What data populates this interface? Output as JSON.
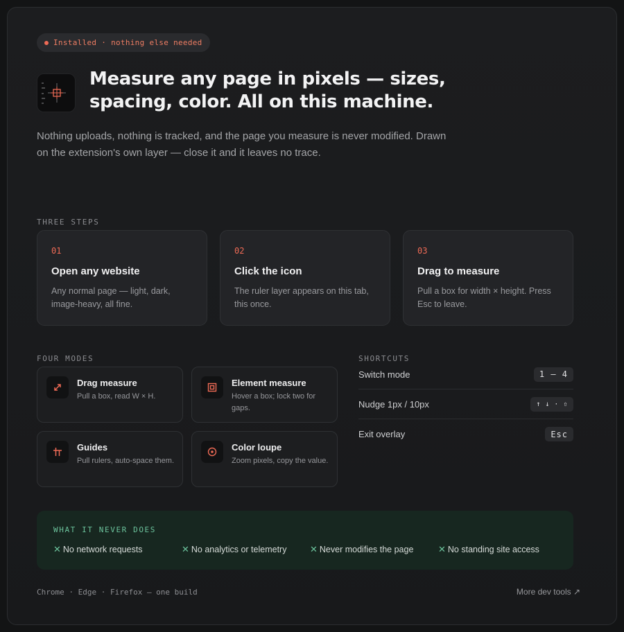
{
  "badge": {
    "text": "Installed · nothing else needed"
  },
  "header": {
    "icon": "crosshair-ruler-icon",
    "title": "Measure any page in pixels — sizes, spacing, color. All on this machine.",
    "subtitle": "Nothing uploads, nothing is tracked, and the page you measure is never modified. Drawn on the extension's own layer — close it and it leaves no trace."
  },
  "steps": {
    "label": "THREE STEPS",
    "items": [
      {
        "num": "01",
        "title": "Open any website",
        "desc": "Any normal page — light, dark, image-heavy, all fine."
      },
      {
        "num": "02",
        "title": "Click the icon",
        "desc": "The ruler layer appears on this tab, this once."
      },
      {
        "num": "03",
        "title": "Drag to measure",
        "desc": "Pull a box for width × height. Press Esc to leave."
      }
    ]
  },
  "modes": {
    "label": "FOUR MODES",
    "items": [
      {
        "icon": "drag-arrows-icon",
        "title": "Drag measure",
        "desc": "Pull a box, read W × H."
      },
      {
        "icon": "element-box-icon",
        "title": "Element measure",
        "desc": "Hover a box; lock two for gaps."
      },
      {
        "icon": "guides-icon",
        "title": "Guides",
        "desc": "Pull rulers, auto-space them."
      },
      {
        "icon": "color-loupe-icon",
        "title": "Color loupe",
        "desc": "Zoom pixels, copy the value."
      }
    ]
  },
  "shortcuts": {
    "label": "SHORTCUTS",
    "items": [
      {
        "action": "Switch mode",
        "keys": "1 – 4"
      },
      {
        "action": "Nudge 1px / 10px",
        "keys": "↑ ↓ · ⇧"
      },
      {
        "action": "Exit overlay",
        "keys": "Esc"
      }
    ]
  },
  "never": {
    "label": "WHAT IT NEVER DOES",
    "items": [
      "No network requests",
      "No analytics or telemetry",
      "Never modifies the page",
      "No standing site access"
    ]
  },
  "footer": {
    "browsers": "Chrome · Edge · Firefox — one build",
    "link": "More dev tools ↗"
  },
  "colors": {
    "accent": "#ef6b56",
    "green": "#6cc39c",
    "background": "#1c1d1f"
  }
}
